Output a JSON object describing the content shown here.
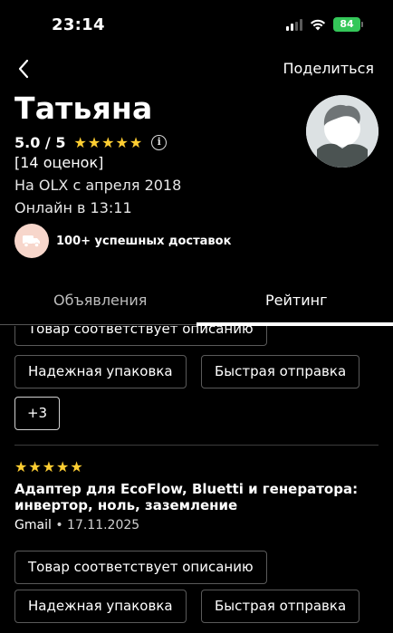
{
  "status_bar": {
    "time": "23:14",
    "battery": "84",
    "battery_color": "#34c759",
    "icons": [
      "signal-icon",
      "wifi-icon",
      "battery-icon"
    ]
  },
  "nav": {
    "back_icon": "chevron-left-icon",
    "share_label": "Поделиться"
  },
  "profile": {
    "name": "Татьяна",
    "rating": "5.0 / 5",
    "stars": 5,
    "star_color": "#ffce32",
    "reviews_count": "[14 оценок]",
    "member_since": "На OLX с апреля 2018",
    "online": "Онлайн в 13:11",
    "delivery_text": "100+ успешных доставок",
    "delivery_icon": "truck-icon",
    "avatar_icon": "user-avatar-icon"
  },
  "tabs": [
    {
      "label": "Объявления",
      "active": false
    },
    {
      "label": "Рейтинг",
      "active": true
    }
  ],
  "reviews": [
    {
      "tags": [
        "Товар соответствует описанию",
        "Надежная упаковка",
        "Быстрая отправка"
      ],
      "more": "+3"
    },
    {
      "stars": 5,
      "title": "Адаптер для EcoFlow, Bluetti и генератора: инвертор, ноль, заземление",
      "author": "Gmail",
      "date": "17.11.2025",
      "tags": [
        "Товар соответствует описанию",
        "Надежная упаковка",
        "Быстрая отправка"
      ]
    }
  ]
}
